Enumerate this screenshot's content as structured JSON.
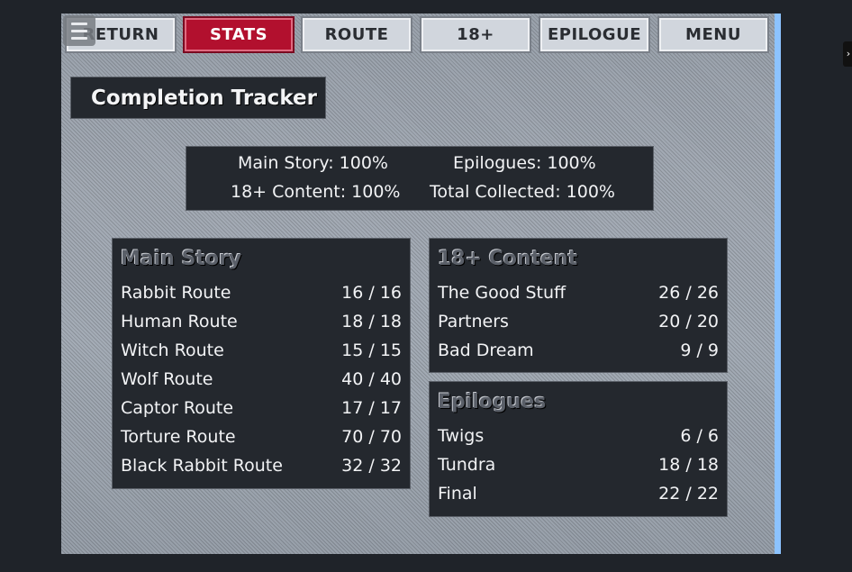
{
  "nav": {
    "buttons": [
      {
        "label": "RETURN"
      },
      {
        "label": "STATS"
      },
      {
        "label": "ROUTE"
      },
      {
        "label": "18+"
      },
      {
        "label": "EPILOGUE"
      },
      {
        "label": "MENU"
      }
    ],
    "active": "STATS",
    "menu_icon": "hamburger-icon"
  },
  "title": "Completion Tracker",
  "summary": {
    "main_story": "Main Story: 100%",
    "epilogues": "Epilogues: 100%",
    "adult_content": "18+ Content: 100%",
    "total": "Total Collected: 100%"
  },
  "sections": {
    "main_story": {
      "title": "Main Story",
      "rows": [
        {
          "label": "Rabbit Route",
          "value": "16 / 16"
        },
        {
          "label": "Human Route",
          "value": "18 / 18"
        },
        {
          "label": "Witch Route",
          "value": "15 / 15"
        },
        {
          "label": "Wolf Route",
          "value": "40 / 40"
        },
        {
          "label": "Captor Route",
          "value": "17 / 17"
        },
        {
          "label": "Torture Route",
          "value": "70 / 70"
        },
        {
          "label": "Black Rabbit Route",
          "value": "32 / 32"
        }
      ]
    },
    "adult_content": {
      "title": "18+ Content",
      "rows": [
        {
          "label": "The Good Stuff",
          "value": "26 / 26"
        },
        {
          "label": "Partners",
          "value": "20 / 20"
        },
        {
          "label": "Bad Dream",
          "value": "9 / 9"
        }
      ]
    },
    "epilogues": {
      "title": "Epilogues",
      "rows": [
        {
          "label": "Twigs",
          "value": "6 / 6"
        },
        {
          "label": "Tundra",
          "value": "18 / 18"
        },
        {
          "label": "Final",
          "value": "22 / 22"
        }
      ]
    }
  },
  "colors": {
    "active_tab": "#b2102e",
    "tab_bg": "#d1d6dd",
    "panel_bg": "#24282e",
    "scrollbar": "#8cc3ff"
  }
}
